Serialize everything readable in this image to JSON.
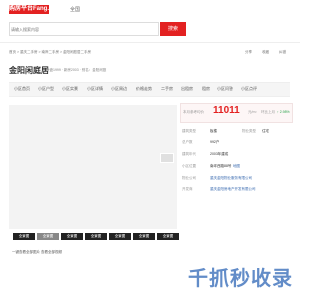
{
  "header": {
    "logo": "购房平台Fang.com",
    "city": "全国"
  },
  "search": {
    "placeholder": "请输入搜索内容",
    "button": "搜索"
  },
  "breadcrumb": "首页 > 重庆二手房 > 南岸二手房 > 金阳闲庭居二手房",
  "top_links": [
    "分享",
    "收藏",
    "纠错"
  ],
  "property": {
    "title": "金阳闲庭居",
    "subtitle": "开盘1999 · 新房2003 · 别名：金阳闲庭"
  },
  "tabs": [
    "小区首页",
    "小区户型",
    "小区实景",
    "小区详情",
    "小区周边",
    "价格走势",
    "二手房",
    "出租房",
    "租房",
    "小区问答",
    "小区点评"
  ],
  "photo": {
    "thumbs": [
      "全景图",
      "全景图",
      "全景图",
      "全景图",
      "全景图",
      "全景图",
      "全景图"
    ],
    "footer": "一键查看全部图片  查看全部视频"
  },
  "info": {
    "price_label": "本月参考均价",
    "price": "11011",
    "price_unit": "元/m²",
    "change_label": "环比上月",
    "change": "↑ 2.98%",
    "rows": [
      {
        "label": "建筑类型",
        "value": "板楼",
        "label2": "物业类型",
        "value2": "住宅"
      },
      {
        "label": "总户数",
        "value": "992户",
        "label2": "",
        "value2": ""
      },
      {
        "label": "建筑年代",
        "value": "2003年建成",
        "label2": "",
        "value2": ""
      },
      {
        "label": "小区位置",
        "value": "南坪西路88号",
        "label2": "",
        "value2": "地图"
      },
      {
        "label": "物业公司",
        "value": "重庆金阳物业服务有限公司",
        "label2": "",
        "value2": ""
      },
      {
        "label": "开发商",
        "value": "重庆金阳房地产开发有限公司",
        "label2": "",
        "value2": ""
      }
    ]
  },
  "watermark": "千抓秒收录"
}
